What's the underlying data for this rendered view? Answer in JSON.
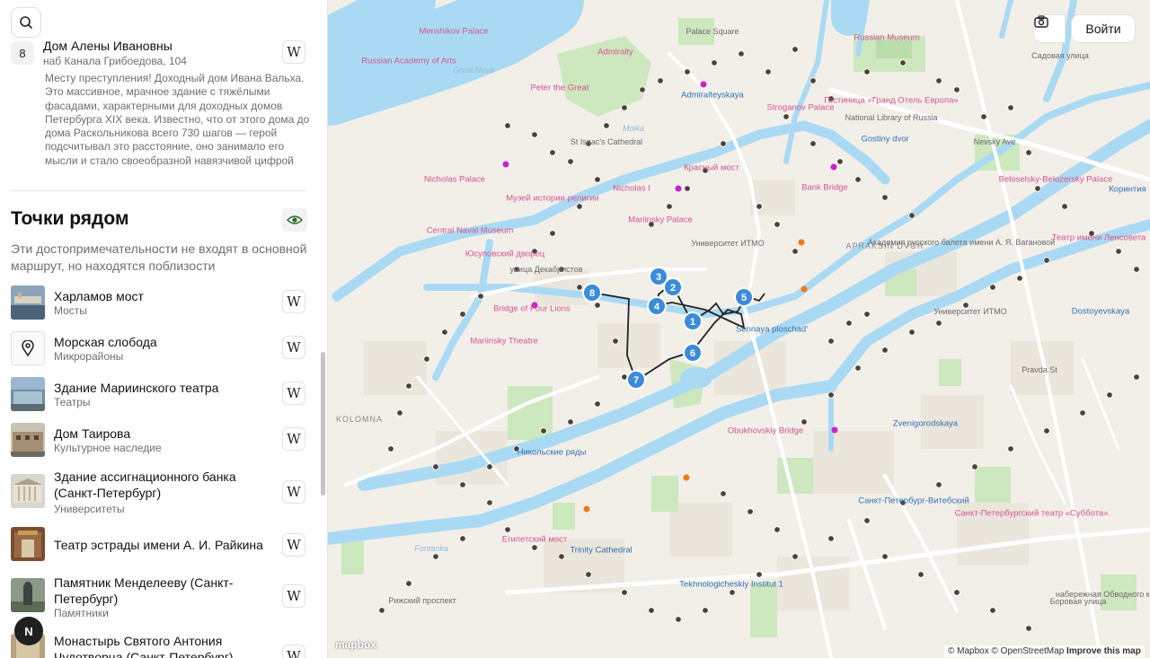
{
  "sidebar": {
    "main_point": {
      "number": "8",
      "title": "Дом Алены Ивановны",
      "address": "наб Канала Грибоедова, 104",
      "description": "Месту преступления! Доходный дом Ивана Вальха. Это массивное, мрачное здание с тяжёлыми фасадами, характерными для доходных домов Петербурга XIX века. Известно, что от этого дома до дома Раскольникова всего 730 шагов — герой подсчитывал это расстояние, оно занимало его мысли и стало своеобразной навязчивой цифрой"
    },
    "wiki_label": "W",
    "nearby": {
      "title": "Точки рядом",
      "subtitle": "Эти достопримечательности не входят в основной маршрут, но находятся поблизости",
      "items": [
        {
          "title": "Харламов мост",
          "category": "Мосты",
          "thumb": "photo"
        },
        {
          "title": "Морская слобода",
          "category": "Микрорайоны",
          "thumb": "pin-icon"
        },
        {
          "title": "Здание Мариинского театра",
          "category": "Театры",
          "thumb": "photo"
        },
        {
          "title": "Дом Таирова",
          "category": "Культурное наследие",
          "thumb": "photo"
        },
        {
          "title": "Здание ассигнационного банка (Санкт-Петербург)",
          "category": "Университеты",
          "thumb": "photo"
        },
        {
          "title": "Театр эстрады имени А. И. Райкина",
          "category": "",
          "thumb": "photo"
        },
        {
          "title": "Памятник Менделееву (Санкт-Петербург)",
          "category": "Памятники",
          "thumb": "photo"
        },
        {
          "title": "Монастырь Святого Антония Чудотворца (Санкт-Петербург)",
          "category": "",
          "thumb": "photo"
        }
      ]
    },
    "nav_letter": "N"
  },
  "map": {
    "login_label": "Войти",
    "logo_text": "mapbox",
    "attribution": {
      "mapbox": "© Mapbox",
      "osm": "© OpenStreetMap",
      "improve": "Improve this map"
    },
    "route_markers": [
      "1",
      "2",
      "3",
      "4",
      "5",
      "6",
      "7",
      "8"
    ],
    "labels": [
      {
        "text": "Menshikov Palace",
        "kind": "poi"
      },
      {
        "text": "Russian Academy of Arts",
        "kind": "poi"
      },
      {
        "text": "Admiralty",
        "kind": "poi"
      },
      {
        "text": "Peter the Great",
        "kind": "poi"
      },
      {
        "text": "Palace Square",
        "kind": "street"
      },
      {
        "text": "Russian Museum",
        "kind": "poi"
      },
      {
        "text": "Гостиница «Гранд Отель Европа»",
        "kind": "poi"
      },
      {
        "text": "Admiralteyskaya",
        "kind": "metro"
      },
      {
        "text": "Stroganov Palace",
        "kind": "poi"
      },
      {
        "text": "St Isaac's Cathedral",
        "kind": "street"
      },
      {
        "text": "Gostiny dvor",
        "kind": "metro"
      },
      {
        "text": "National Library of Russia",
        "kind": "street"
      },
      {
        "text": "Nevsky Ave",
        "kind": "street"
      },
      {
        "text": "Nicholas Palace",
        "kind": "poi"
      },
      {
        "text": "Музей истории религии",
        "kind": "poi"
      },
      {
        "text": "Nicholas I",
        "kind": "poi"
      },
      {
        "text": "Красный мост",
        "kind": "poi"
      },
      {
        "text": "Bank Bridge",
        "kind": "poi"
      },
      {
        "text": "Beloselsky-Belozersky Palace",
        "kind": "poi"
      },
      {
        "text": "Коринтия",
        "kind": "metro"
      },
      {
        "text": "Mariinsky Palace",
        "kind": "poi"
      },
      {
        "text": "Central Naval Museum",
        "kind": "poi"
      },
      {
        "text": "Университет ИТМО",
        "kind": "street"
      },
      {
        "text": "APRAKSIN DVOR",
        "kind": "dist"
      },
      {
        "text": "Академия русского балета имени А. Я. Вагановой",
        "kind": "street"
      },
      {
        "text": "Театр имени Ленсовета",
        "kind": "poi"
      },
      {
        "text": "Юсуповский дворец",
        "kind": "poi"
      },
      {
        "text": "улица Декабристов",
        "kind": "street"
      },
      {
        "text": "Bridge of Four Lions",
        "kind": "poi"
      },
      {
        "text": "Sennaya ploschad'",
        "kind": "metro"
      },
      {
        "text": "Университет ИТМО",
        "kind": "street"
      },
      {
        "text": "Dostoyevskaya",
        "kind": "metro"
      },
      {
        "text": "Mariinsky Theatre",
        "kind": "poi"
      },
      {
        "text": "KOLOMNA",
        "kind": "dist"
      },
      {
        "text": "Obukhovskiy Bridge",
        "kind": "poi"
      },
      {
        "text": "Zvenigorodskaya",
        "kind": "metro"
      },
      {
        "text": "Никольские ряды",
        "kind": "metro"
      },
      {
        "text": "Санкт-Петербург-Витебский",
        "kind": "metro"
      },
      {
        "text": "Санкт-Петербургский театр «Суббота»",
        "kind": "poi"
      },
      {
        "text": "Египетский мост",
        "kind": "poi"
      },
      {
        "text": "Trinity Cathedral",
        "kind": "metro"
      },
      {
        "text": "Tekhnologicheskiy Institut 1",
        "kind": "metro"
      },
      {
        "text": "Рижский проспект",
        "kind": "street"
      },
      {
        "text": "Fontanka",
        "kind": "water"
      },
      {
        "text": "Great Neva",
        "kind": "water"
      },
      {
        "text": "Moika",
        "kind": "water"
      },
      {
        "text": "Садовая улица",
        "kind": "street"
      },
      {
        "text": "Pravda St",
        "kind": "street"
      },
      {
        "text": "набережная Обводного канала",
        "kind": "street"
      },
      {
        "text": "Боровая улица",
        "kind": "street"
      }
    ]
  }
}
